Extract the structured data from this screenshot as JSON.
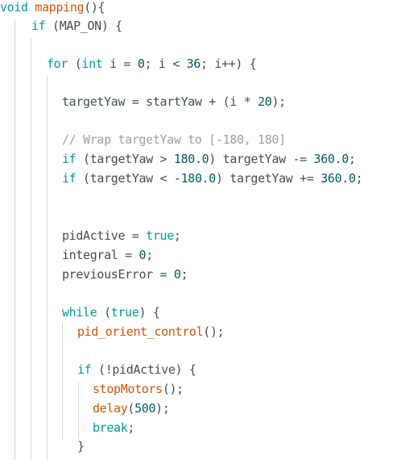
{
  "editor": {
    "theme": {
      "background": "#ffffff",
      "plain": "#434f54",
      "keyword": "#00979c",
      "function": "#d35400",
      "number": "#005c5f",
      "comment": "#95a5a6",
      "indent_guide": "#d4d4d4"
    },
    "lines": [
      {
        "indent": 0,
        "tokens": [
          {
            "t": "void",
            "c": "kw"
          },
          {
            "t": " ",
            "c": "plain"
          },
          {
            "t": "mapping",
            "c": "fn"
          },
          {
            "t": "(){",
            "c": "plain"
          }
        ]
      },
      {
        "indent": 2,
        "tokens": [
          {
            "t": "if",
            "c": "kw"
          },
          {
            "t": " (MAP_ON) {",
            "c": "plain"
          }
        ]
      },
      {
        "indent": 0,
        "tokens": []
      },
      {
        "indent": 4,
        "tokens": [
          {
            "t": "for",
            "c": "kw"
          },
          {
            "t": " (",
            "c": "plain"
          },
          {
            "t": "int",
            "c": "kw"
          },
          {
            "t": " i = ",
            "c": "plain"
          },
          {
            "t": "0",
            "c": "num"
          },
          {
            "t": "; i < ",
            "c": "plain"
          },
          {
            "t": "36",
            "c": "num"
          },
          {
            "t": "; i++) {",
            "c": "plain"
          }
        ]
      },
      {
        "indent": 0,
        "tokens": []
      },
      {
        "indent": 5,
        "tokens": [
          {
            "t": "targetYaw = startYaw + (i * ",
            "c": "plain"
          },
          {
            "t": "20",
            "c": "num"
          },
          {
            "t": ");",
            "c": "plain"
          }
        ]
      },
      {
        "indent": 0,
        "tokens": []
      },
      {
        "indent": 5,
        "tokens": [
          {
            "t": "// Wrap targetYaw to [-180, 180]",
            "c": "cm"
          }
        ]
      },
      {
        "indent": 5,
        "tokens": [
          {
            "t": "if",
            "c": "kw"
          },
          {
            "t": " (targetYaw > ",
            "c": "plain"
          },
          {
            "t": "180.0",
            "c": "num"
          },
          {
            "t": ") targetYaw -= ",
            "c": "plain"
          },
          {
            "t": "360.0",
            "c": "num"
          },
          {
            "t": ";",
            "c": "plain"
          }
        ]
      },
      {
        "indent": 5,
        "tokens": [
          {
            "t": "if",
            "c": "kw"
          },
          {
            "t": " (targetYaw < ",
            "c": "plain"
          },
          {
            "t": "-180.0",
            "c": "num"
          },
          {
            "t": ") targetYaw += ",
            "c": "plain"
          },
          {
            "t": "360.0",
            "c": "num"
          },
          {
            "t": ";",
            "c": "plain"
          }
        ]
      },
      {
        "indent": 0,
        "tokens": []
      },
      {
        "indent": 0,
        "tokens": []
      },
      {
        "indent": 5,
        "tokens": [
          {
            "t": "pidActive = ",
            "c": "plain"
          },
          {
            "t": "true",
            "c": "kw"
          },
          {
            "t": ";",
            "c": "plain"
          }
        ]
      },
      {
        "indent": 5,
        "tokens": [
          {
            "t": "integral = ",
            "c": "plain"
          },
          {
            "t": "0",
            "c": "num"
          },
          {
            "t": ";",
            "c": "plain"
          }
        ]
      },
      {
        "indent": 5,
        "tokens": [
          {
            "t": "previousError = ",
            "c": "plain"
          },
          {
            "t": "0",
            "c": "num"
          },
          {
            "t": ";",
            "c": "plain"
          }
        ]
      },
      {
        "indent": 0,
        "tokens": []
      },
      {
        "indent": 5,
        "tokens": [
          {
            "t": "while",
            "c": "kw"
          },
          {
            "t": " (",
            "c": "plain"
          },
          {
            "t": "true",
            "c": "kw"
          },
          {
            "t": ") {",
            "c": "plain"
          }
        ]
      },
      {
        "indent": 6,
        "tokens": [
          {
            "t": "pid_orient_control",
            "c": "fn"
          },
          {
            "t": "();",
            "c": "plain"
          }
        ]
      },
      {
        "indent": 0,
        "tokens": []
      },
      {
        "indent": 6,
        "tokens": [
          {
            "t": "if",
            "c": "kw"
          },
          {
            "t": " (!pidActive) {",
            "c": "plain"
          }
        ]
      },
      {
        "indent": 7,
        "tokens": [
          {
            "t": "stopMotors",
            "c": "fn"
          },
          {
            "t": "();",
            "c": "plain"
          }
        ]
      },
      {
        "indent": 7,
        "tokens": [
          {
            "t": "delay",
            "c": "fn"
          },
          {
            "t": "(",
            "c": "plain"
          },
          {
            "t": "500",
            "c": "num"
          },
          {
            "t": ");",
            "c": "plain"
          }
        ]
      },
      {
        "indent": 7,
        "tokens": [
          {
            "t": "break",
            "c": "kw"
          },
          {
            "t": ";",
            "c": "plain"
          }
        ]
      },
      {
        "indent": 6,
        "tokens": [
          {
            "t": "}",
            "c": "plain"
          }
        ]
      }
    ]
  }
}
